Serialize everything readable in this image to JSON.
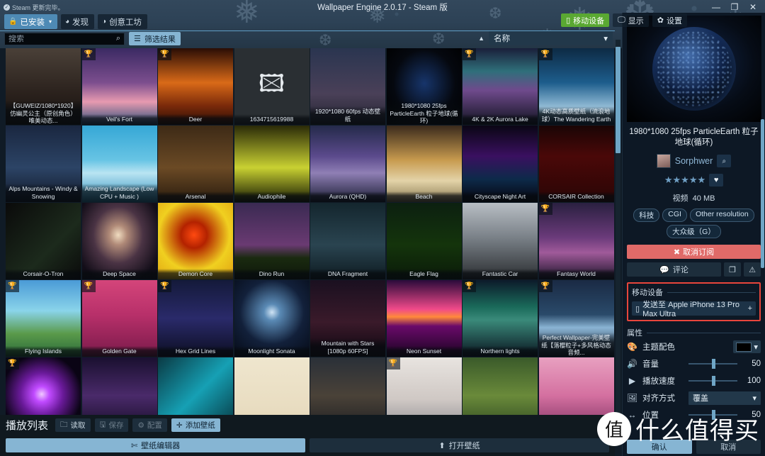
{
  "window": {
    "title": "Wallpaper Engine 2.0.17 - Steam 版",
    "steam_note": "Steam 更新完毕。",
    "minimize": "—",
    "maximize": "❐",
    "close": "✕"
  },
  "nav": {
    "tabs": [
      {
        "label": "已安装",
        "icon": "lock-icon",
        "active": true,
        "caret": "▾"
      },
      {
        "label": "发现",
        "icon": "compass-icon",
        "active": false
      },
      {
        "label": "创意工坊",
        "icon": "workshop-icon",
        "active": false
      }
    ]
  },
  "header_actions": [
    {
      "label": "移动设备",
      "icon": "phone-icon",
      "style": "green"
    },
    {
      "label": "显示",
      "icon": "monitor-icon",
      "style": "dark"
    },
    {
      "label": "设置",
      "icon": "gear-icon",
      "style": "dark"
    }
  ],
  "search": {
    "placeholder": "搜索",
    "value": "",
    "icon": "search-icon"
  },
  "filter_button": {
    "label": "筛选结果",
    "icon": "filter-icon"
  },
  "sort": {
    "label": "名称",
    "caret": "▾",
    "asc_icon": "▲"
  },
  "grid": {
    "tiles": [
      {
        "label": "【GUWEIZ/1080*1920】 仿幽灵公主（原创角色）唯美动态...",
        "trophy": false,
        "art": "portrait-hooded-girl",
        "selected": false
      },
      {
        "label": "Veil's Fort",
        "trophy": true,
        "art": "fantasy-castle",
        "selected": false
      },
      {
        "label": "Deer",
        "trophy": true,
        "art": "fire-forest",
        "selected": false
      },
      {
        "label": "1634715619988",
        "trophy": false,
        "art": "broken-image",
        "selected": false
      },
      {
        "label": "1920*1080 60fps 动态壁纸",
        "trophy": false,
        "art": "anime-girl-night",
        "selected": false
      },
      {
        "label": "1980*1080 25fps ParticleEarth 粒子地球(循环)",
        "trophy": false,
        "art": "particle-earth",
        "selected": true
      },
      {
        "label": "4K & 2K Aurora Lake",
        "trophy": true,
        "art": "aurora-lake",
        "selected": false
      },
      {
        "label": "4K动态高质壁纸（流浪地球）The Wandering Earth",
        "trophy": true,
        "art": "wandering-earth",
        "selected": false
      },
      {
        "label": "Alps Mountains - Windy & Snowing",
        "trophy": false,
        "art": "alps-night",
        "selected": false
      },
      {
        "label": "Amazing Landscape (Low CPU + Music )",
        "trophy": false,
        "art": "sea-sunrise",
        "selected": false
      },
      {
        "label": "Arsenal",
        "trophy": false,
        "art": "guns-wood",
        "selected": false
      },
      {
        "label": "Audiophile",
        "trophy": false,
        "art": "audio-bars",
        "selected": false
      },
      {
        "label": "Aurora (QHD)",
        "trophy": false,
        "art": "aurora-purple",
        "selected": false
      },
      {
        "label": "Beach",
        "trophy": false,
        "art": "beach-palm",
        "selected": false
      },
      {
        "label": "Cityscape Night Art",
        "trophy": false,
        "art": "city-night",
        "selected": false
      },
      {
        "label": "CORSAIR Collection",
        "trophy": false,
        "art": "corsair-circuit",
        "selected": false
      },
      {
        "label": "Corsair-O-Tron",
        "trophy": false,
        "art": "corsair-otron",
        "selected": false
      },
      {
        "label": "Deep Space",
        "trophy": false,
        "art": "galaxy",
        "selected": false
      },
      {
        "label": "Demon Core",
        "trophy": false,
        "art": "demon-core",
        "selected": false
      },
      {
        "label": "Dino Run",
        "trophy": false,
        "art": "dino-run",
        "selected": false
      },
      {
        "label": "DNA Fragment",
        "trophy": false,
        "art": "dna-helix",
        "selected": false
      },
      {
        "label": "Eagle Flag",
        "trophy": false,
        "art": "eagle-flag",
        "selected": false
      },
      {
        "label": "Fantastic Car",
        "trophy": false,
        "art": "red-car",
        "selected": false
      },
      {
        "label": "Fantasy World",
        "trophy": true,
        "art": "fantasy-tree",
        "selected": false
      },
      {
        "label": "Flying Islands",
        "trophy": true,
        "art": "flying-islands",
        "selected": false
      },
      {
        "label": "Golden Gate",
        "trophy": true,
        "art": "golden-gate",
        "selected": false
      },
      {
        "label": "Hex Grid Lines",
        "trophy": true,
        "art": "hex-grid",
        "selected": false
      },
      {
        "label": "Moonlight Sonata",
        "trophy": false,
        "art": "moon-night",
        "selected": false
      },
      {
        "label": "Mountain with Stars [1080p 60FPS]",
        "trophy": false,
        "art": "mountain-stars",
        "selected": false
      },
      {
        "label": "Neon Sunset",
        "trophy": false,
        "art": "neon-sunset",
        "selected": false
      },
      {
        "label": "Northern lights",
        "trophy": true,
        "art": "northern-lights",
        "selected": false
      },
      {
        "label": "Perfect Wallpaper-完美壁纸【落樱粒子+多风格动态音频...",
        "trophy": true,
        "art": "cherry-ring",
        "selected": false
      },
      {
        "label": "",
        "trophy": true,
        "art": "purple-burst",
        "selected": false
      },
      {
        "label": "",
        "trophy": false,
        "art": "iso-room",
        "selected": false
      },
      {
        "label": "",
        "trophy": false,
        "art": "razer-hex",
        "selected": false
      },
      {
        "label": "",
        "trophy": false,
        "art": "retro-paper",
        "selected": false
      },
      {
        "label": "",
        "trophy": false,
        "art": "spaceship",
        "selected": false
      },
      {
        "label": "",
        "trophy": true,
        "art": "anime-girl-white",
        "selected": false
      },
      {
        "label": "",
        "trophy": false,
        "art": "sheep-field",
        "selected": false
      },
      {
        "label": "",
        "trophy": false,
        "art": "pink-cloud",
        "selected": false
      }
    ]
  },
  "playlist": {
    "title": "播放列表",
    "buttons": [
      {
        "label": "读取",
        "icon": "folder-icon",
        "style": "normal"
      },
      {
        "label": "保存",
        "icon": "save-icon",
        "style": "dim"
      },
      {
        "label": "配置",
        "icon": "wrench-icon",
        "style": "dim"
      },
      {
        "label": "添加壁纸",
        "icon": "plus-icon",
        "style": "light"
      }
    ],
    "wide_buttons": [
      {
        "label": "壁纸编辑器",
        "icon": "tools-icon",
        "style": "prim"
      },
      {
        "label": "打开壁纸",
        "icon": "upload-icon",
        "style": "sec"
      }
    ]
  },
  "sidebar": {
    "title": "1980*1080 25fps ParticleEarth 粒子地球(循环)",
    "author": "Sorphwer",
    "author_search_icon": "search-icon",
    "stars": "★★★★★",
    "favorite_icon": "heart-icon",
    "type": "视频",
    "size": "40 MB",
    "tags": [
      "科技",
      "CGI",
      "Other resolution",
      "大众级（G）"
    ],
    "unsubscribe": "取消订阅",
    "comment": "评论",
    "copy_icon": "copy-icon",
    "report_icon": "warning-icon",
    "mobile_section": "移动设备",
    "send_to": "发送至 Apple iPhone 13 Pro Max Ultra",
    "send_plus": "+",
    "properties_section": "属性",
    "props": [
      {
        "icon": "palette-icon",
        "label": "主题配色",
        "kind": "color",
        "value": "#000000"
      },
      {
        "icon": "volume-icon",
        "label": "音量",
        "kind": "slider",
        "value": "50"
      },
      {
        "icon": "play-icon",
        "label": "播放速度",
        "kind": "slider",
        "value": "100"
      },
      {
        "icon": "align-icon",
        "label": "对齐方式",
        "kind": "select",
        "value": "覆盖"
      },
      {
        "icon": "arrows-icon",
        "label": "位置",
        "kind": "slider",
        "value": "50"
      }
    ],
    "confirm": "确认",
    "cancel": "取消"
  },
  "watermark": {
    "mark": "值",
    "text": "什么值得买"
  }
}
